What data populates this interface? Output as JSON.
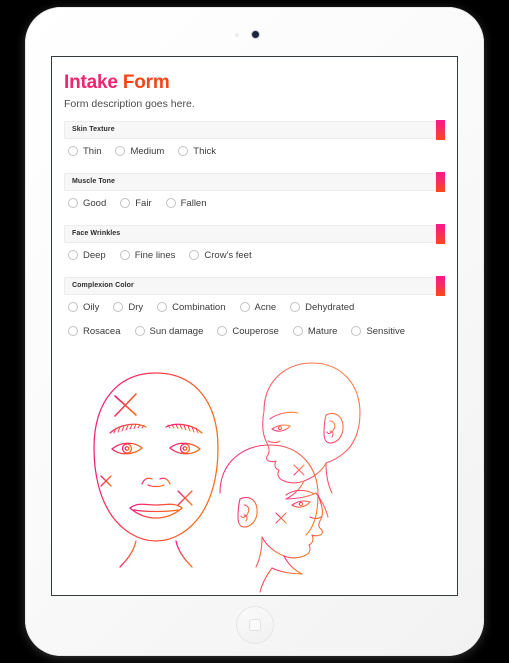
{
  "device": {
    "name": "tablet-mockup",
    "camera_icon": "camera-icon",
    "sensor_icon": "sensor-icon",
    "home_button": "home-button"
  },
  "form": {
    "title_part1": "Intake",
    "title_part2": "Form",
    "description": "Form description goes here.",
    "accent_start": "#f51a8a",
    "accent_end": "#f9481f",
    "title_color_1": "#f0256f",
    "title_color_2": "#f5451a"
  },
  "sections": [
    {
      "label": "Skin Texture",
      "rows": [
        [
          {
            "label": "Thin",
            "selected": false
          },
          {
            "label": "Medium",
            "selected": false
          },
          {
            "label": "Thick",
            "selected": false
          }
        ]
      ]
    },
    {
      "label": "Muscle Tone",
      "rows": [
        [
          {
            "label": "Good",
            "selected": false
          },
          {
            "label": "Fair",
            "selected": false
          },
          {
            "label": "Fallen",
            "selected": false
          }
        ]
      ]
    },
    {
      "label": "Face Wrinkles",
      "rows": [
        [
          {
            "label": "Deep",
            "selected": false
          },
          {
            "label": "Fine lines",
            "selected": false
          },
          {
            "label": "Crow's feet",
            "selected": false
          }
        ]
      ]
    },
    {
      "label": "Complexion Color",
      "rows": [
        [
          {
            "label": "Oily",
            "selected": false
          },
          {
            "label": "Dry",
            "selected": false
          },
          {
            "label": "Combination",
            "selected": false
          },
          {
            "label": "Acne",
            "selected": false
          },
          {
            "label": "Dehydrated",
            "selected": false
          }
        ],
        [
          {
            "label": "Rosacea",
            "selected": false
          },
          {
            "label": "Sun damage",
            "selected": false
          },
          {
            "label": "Couperose",
            "selected": false
          },
          {
            "label": "Mature",
            "selected": false
          },
          {
            "label": "Sensitive",
            "selected": false
          }
        ]
      ]
    }
  ],
  "illustration": {
    "name": "face-diagram",
    "description": "Line drawings of a front-facing face and two profile heads with X annotation marks",
    "stroke_start": "#f5157f",
    "stroke_end": "#f96a18"
  }
}
